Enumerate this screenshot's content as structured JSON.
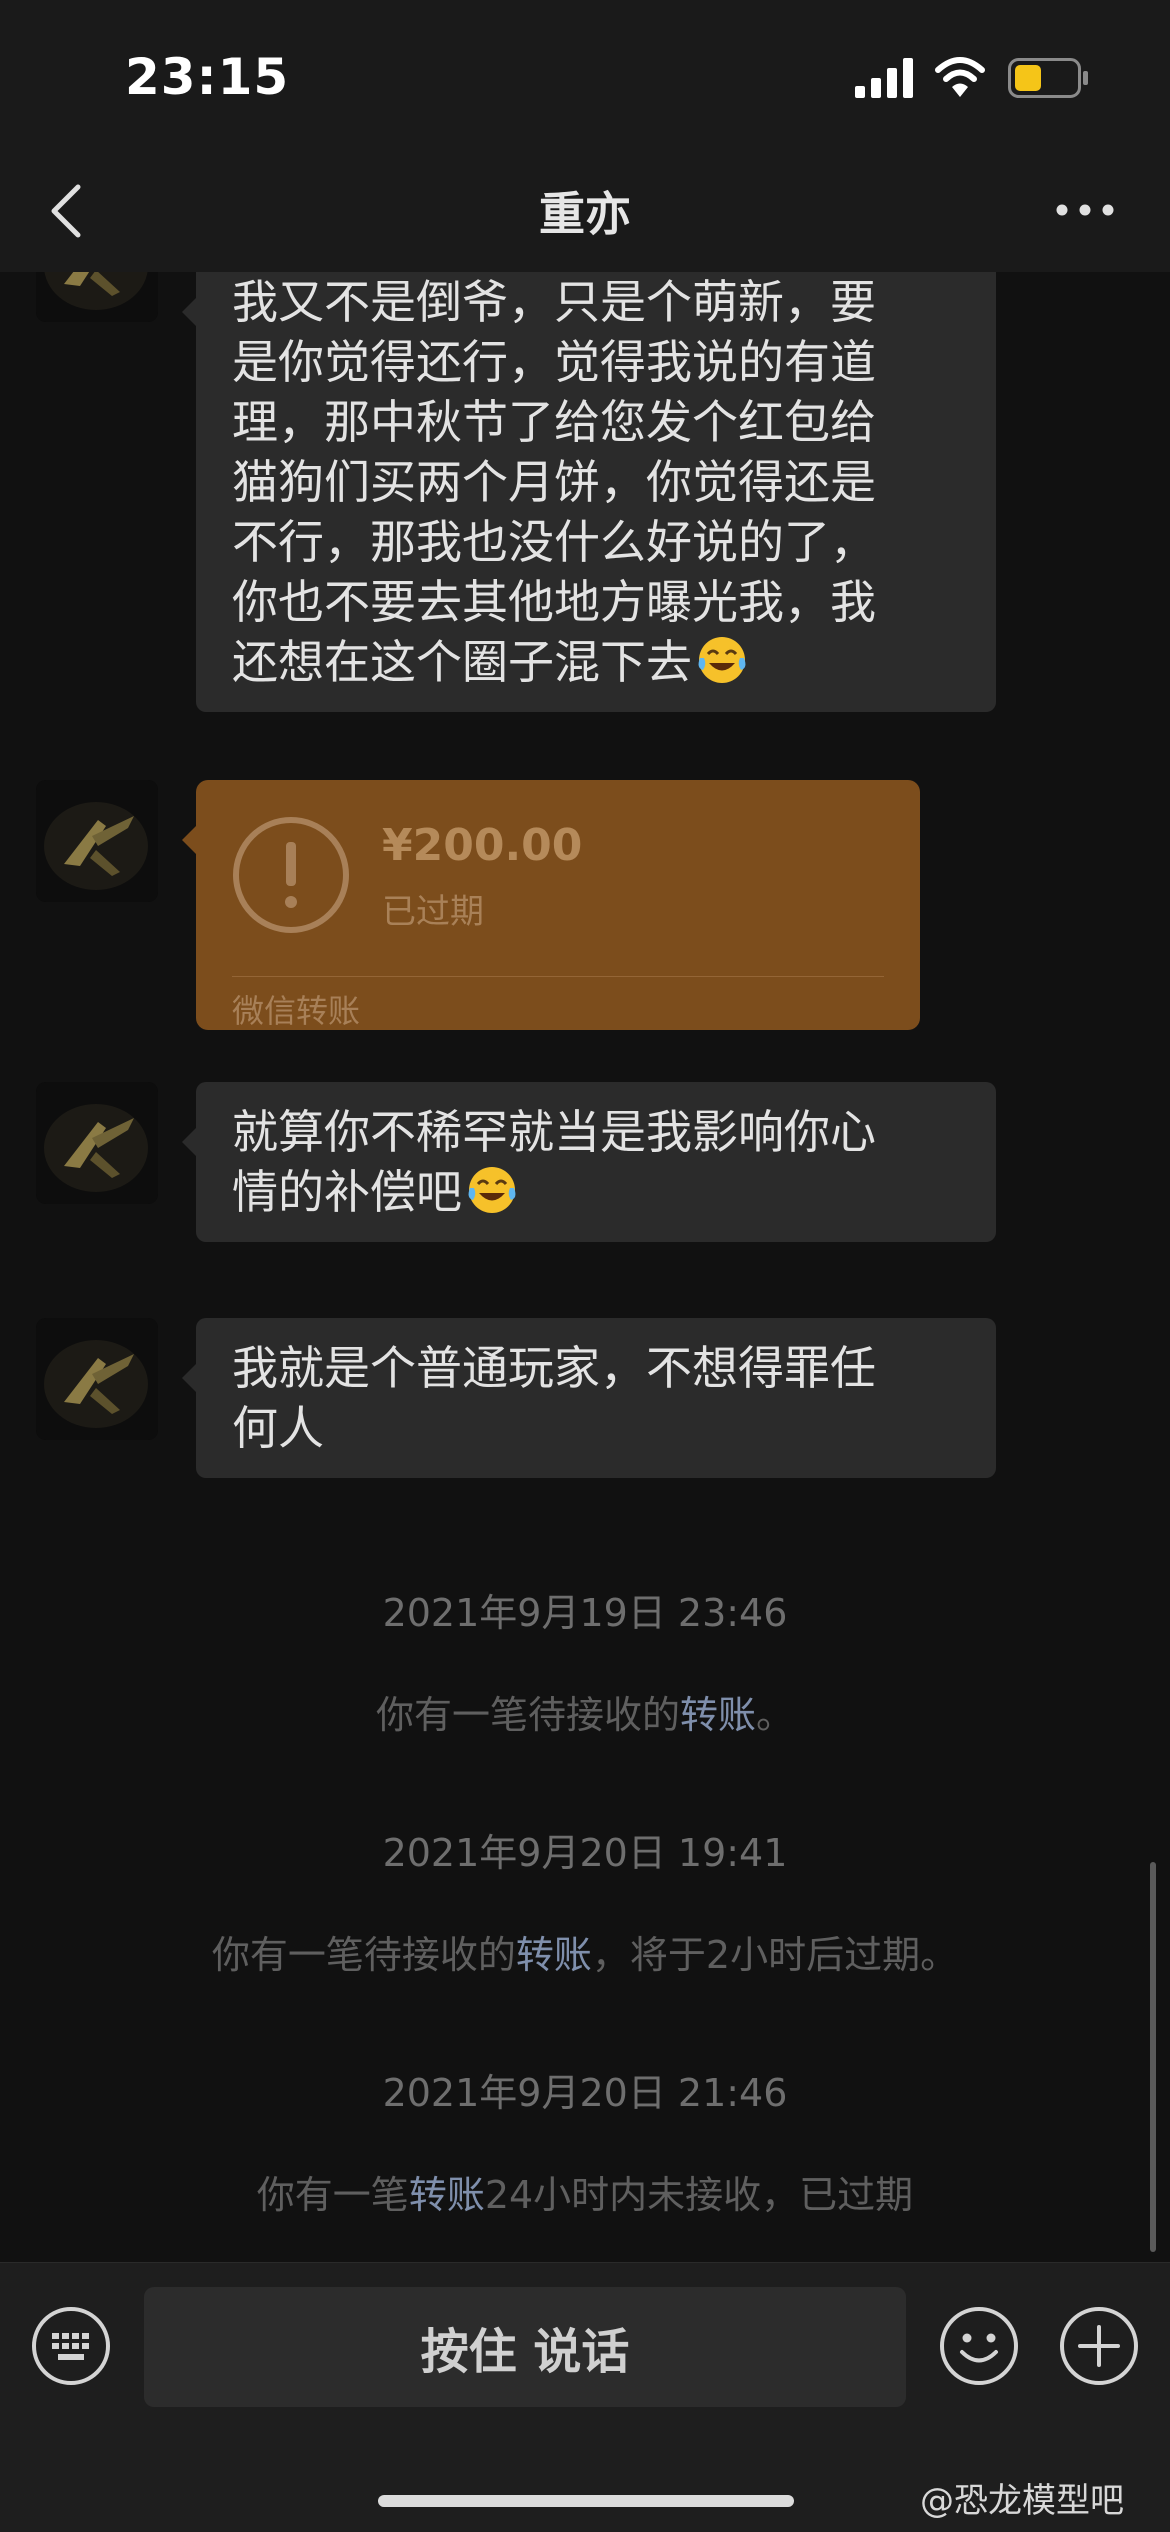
{
  "status_bar": {
    "time": "23:15"
  },
  "header": {
    "title": "重亦"
  },
  "messages": [
    {
      "lines": [
        "我又不是倒爷，只是个萌新，要",
        "是你觉得还行，觉得我说的有道",
        "理，那中秋节了给您发个红包给",
        "猫狗们买两个月饼，你觉得还是",
        "不行，那我也没什么好说的了，",
        "你也不要去其他地方曝光我，我",
        "还想在这个圈子混下去"
      ],
      "emoji": "tears-of-joy-emoji"
    },
    {
      "lines": [
        "就算你不稀罕就当是我影响你心",
        "情的补偿吧"
      ],
      "emoji": "tears-of-joy-emoji"
    },
    {
      "lines": [
        "我就是个普通玩家，不想得罪任",
        "何人"
      ]
    }
  ],
  "transfer": {
    "amount": "¥200.00",
    "status": "已过期",
    "label": "微信转账",
    "icon": "exclamation-circle-icon"
  },
  "system": [
    {
      "time": "2021年9月19日 23:46",
      "before": "你有一笔待接收的",
      "link": "转账",
      "after": "。"
    },
    {
      "time": "2021年9月20日 19:41",
      "before": "你有一笔待接收的",
      "link": "转账",
      "after": "，将于2小时后过期。"
    },
    {
      "time": "2021年9月20日 21:46",
      "before": "你有一笔",
      "link": "转账",
      "after": "24小时内未接收，已过期"
    }
  ],
  "input": {
    "hold_to_talk": "按住 说话"
  },
  "watermark": "@恐龙模型吧",
  "colors": {
    "background": "#111111",
    "bubble": "#2b2b2b",
    "transfer_card": "#7c4d1c",
    "link": "#7f8fac"
  }
}
